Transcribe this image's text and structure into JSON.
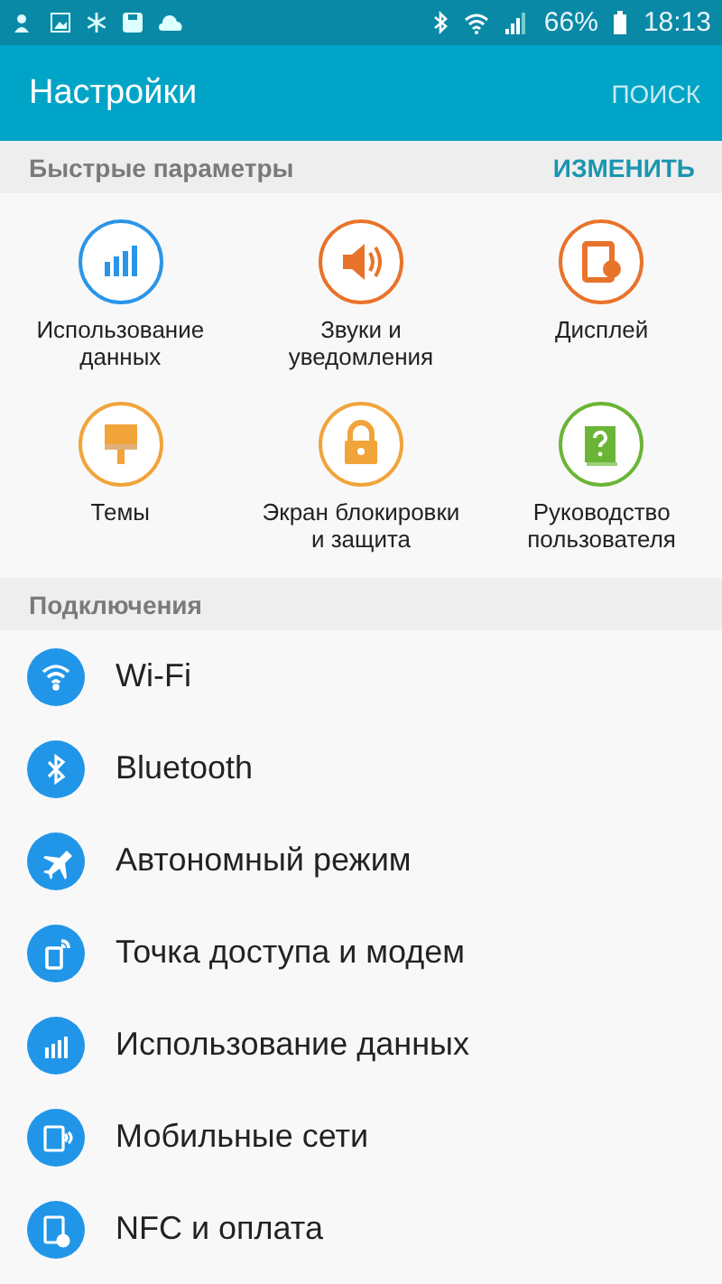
{
  "status_bar": {
    "battery": "66%",
    "time": "18:13"
  },
  "app_bar": {
    "title": "Настройки",
    "action": "ПОИСК"
  },
  "quick_settings": {
    "header": "Быстрые параметры",
    "action": "ИЗМЕНИТЬ",
    "tiles": [
      {
        "label": "Использование данных",
        "color": "#2b95e8"
      },
      {
        "label": "Звуки и уведомления",
        "color": "#e8732a"
      },
      {
        "label": "Дисплей",
        "color": "#e8732a"
      },
      {
        "label": "Темы",
        "color": "#f0a43a"
      },
      {
        "label": "Экран блокировки и защита",
        "color": "#f0a43a"
      },
      {
        "label": "Руководство пользователя",
        "color": "#6bb536"
      }
    ]
  },
  "connections": {
    "header": "Подключения",
    "items": [
      {
        "label": "Wi-Fi"
      },
      {
        "label": "Bluetooth"
      },
      {
        "label": "Автономный режим"
      },
      {
        "label": "Точка доступа и модем"
      },
      {
        "label": "Использование данных"
      },
      {
        "label": "Мобильные сети"
      },
      {
        "label": "NFC и оплата"
      }
    ]
  }
}
